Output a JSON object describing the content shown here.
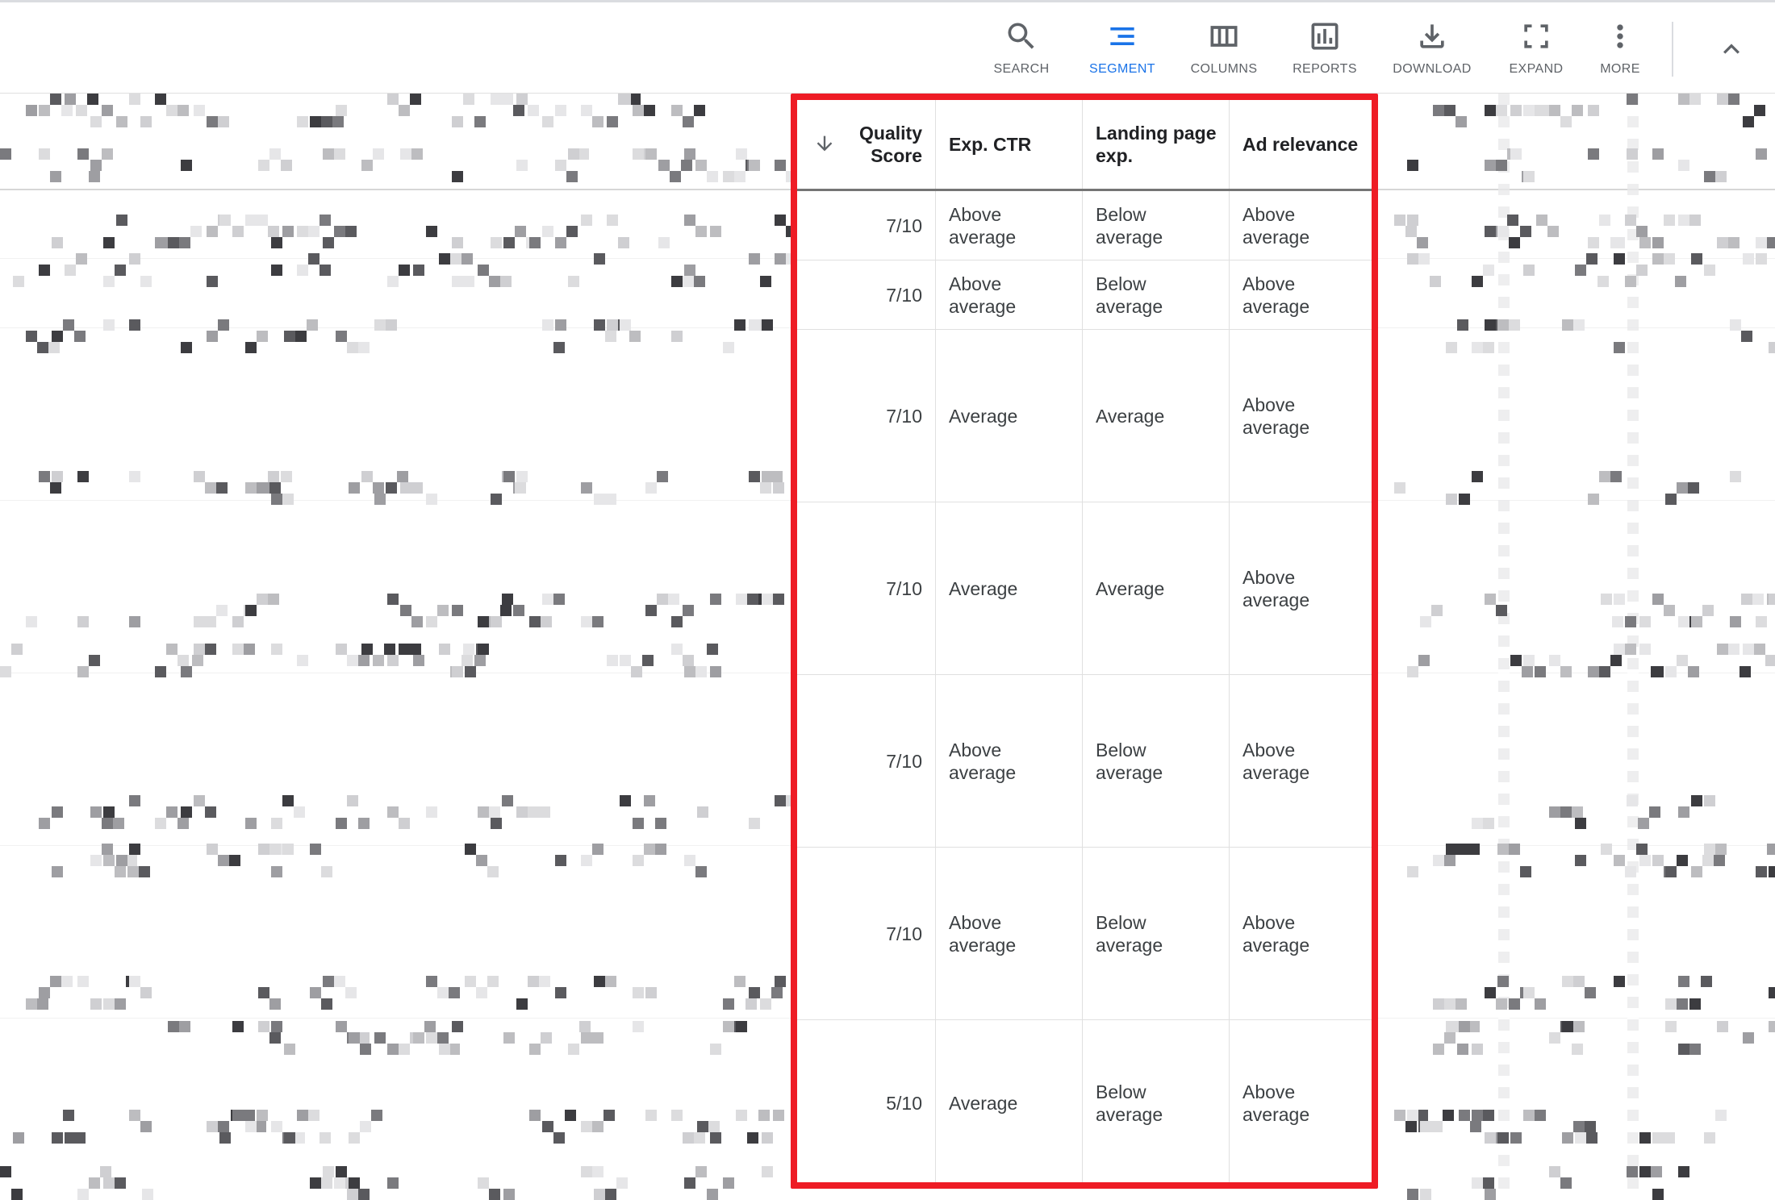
{
  "toolbar": {
    "buttons": [
      {
        "label": "SEARCH",
        "icon": "search-icon"
      },
      {
        "label": "SEGMENT",
        "icon": "segment-icon"
      },
      {
        "label": "COLUMNS",
        "icon": "columns-icon"
      },
      {
        "label": "REPORTS",
        "icon": "reports-icon"
      },
      {
        "label": "DOWNLOAD",
        "icon": "download-icon"
      },
      {
        "label": "EXPAND",
        "icon": "expand-icon"
      },
      {
        "label": "MORE",
        "icon": "more-vert-icon"
      }
    ],
    "active_button": "SEGMENT",
    "collapse_icon": "chevron-up-icon"
  },
  "table": {
    "columns": [
      "Quality Score",
      "Exp. CTR",
      "Landing page exp.",
      "Ad relevance"
    ],
    "sort_icon": "arrow-downward-icon",
    "rows": [
      {
        "quality_score": "7/10",
        "exp_ctr": "Above average",
        "landing_page": "Below average",
        "ad_relevance": "Above average"
      },
      {
        "quality_score": "7/10",
        "exp_ctr": "Above average",
        "landing_page": "Below average",
        "ad_relevance": "Above average"
      },
      {
        "quality_score": "7/10",
        "exp_ctr": "Average",
        "landing_page": "Average",
        "ad_relevance": "Above average"
      },
      {
        "quality_score": "7/10",
        "exp_ctr": "Average",
        "landing_page": "Average",
        "ad_relevance": "Above average"
      },
      {
        "quality_score": "7/10",
        "exp_ctr": "Above average",
        "landing_page": "Below average",
        "ad_relevance": "Above average"
      },
      {
        "quality_score": "7/10",
        "exp_ctr": "Above average",
        "landing_page": "Below average",
        "ad_relevance": "Above average"
      },
      {
        "quality_score": "5/10",
        "exp_ctr": "Average",
        "landing_page": "Below average",
        "ad_relevance": "Above average"
      }
    ]
  },
  "colors": {
    "accent": "#1a73e8",
    "highlight": "#ee1c25",
    "icon": "#5f6368"
  }
}
